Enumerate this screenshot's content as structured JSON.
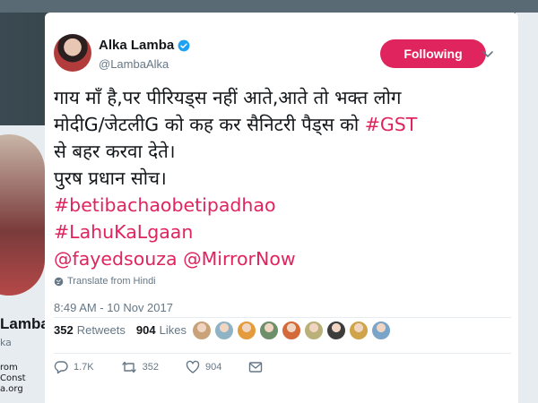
{
  "author": {
    "name": "Alka Lamba",
    "handle": "@LambaAlka",
    "verified_icon": "verified-badge-icon",
    "avatar_colors": [
      "#e7c7b4",
      "#2b1f1f",
      "#b23c3c"
    ]
  },
  "follow_button": {
    "label": "Following",
    "color": "#e0245e"
  },
  "tweet": {
    "lines": [
      {
        "text": "गाय माँ है,पर पीरियड्स नहीं आते,आते तो भक्त लोग",
        "tag": ""
      },
      {
        "text": "मोदीG/जेटलीG को कह कर सैनिटरी पैड्स को ",
        "tag": "#GST"
      },
      {
        "text": "से बहर करवा देते।",
        "tag": ""
      },
      {
        "text": "पुरष प्रधान सोच।",
        "tag": ""
      },
      {
        "text": "",
        "tag": "#betibachaobetipadhao"
      },
      {
        "text": "",
        "tag": "#LahuKaLgaan"
      },
      {
        "text": "",
        "tag": "@fayedsouza @MirrorNow"
      }
    ],
    "translate_label": "Translate from Hindi",
    "timestamp": "8:49 AM - 10 Nov 2017"
  },
  "stats": {
    "retweets_count": "352",
    "retweets_label": "Retweets",
    "likes_count": "904",
    "likes_label": "Likes"
  },
  "likers": [
    "#c9a27a",
    "#8fb3c4",
    "#e49b3c",
    "#6f8f6a",
    "#d46a3a",
    "#b9b07a",
    "#3d3d3d",
    "#cfa44a",
    "#7aa4c8"
  ],
  "actions": {
    "reply_count": "1.7K",
    "retweet_count": "352",
    "like_count": "904"
  },
  "background": {
    "name": "Lamba",
    "handle": "ka",
    "bio_lines": [
      "rom",
      "Const",
      "a.org"
    ]
  },
  "colors": {
    "accent": "#e0245e",
    "muted": "#657786",
    "text": "#14171a",
    "verified": "#1da1f2"
  }
}
